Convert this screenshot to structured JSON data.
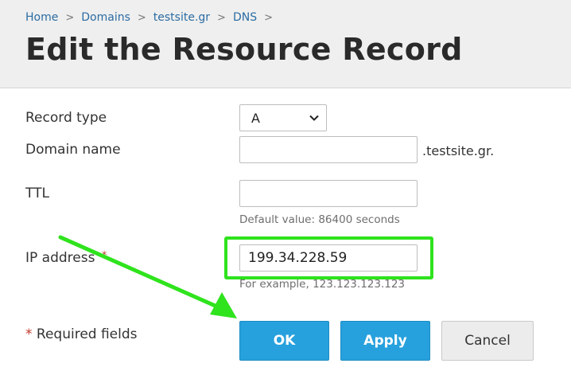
{
  "breadcrumb": {
    "items": [
      "Home",
      "Domains",
      "testsite.gr",
      "DNS"
    ],
    "separator": ">"
  },
  "page": {
    "title": "Edit the Resource Record"
  },
  "form": {
    "record_type": {
      "label": "Record type",
      "value": "A"
    },
    "domain_name": {
      "label": "Domain name",
      "value": "",
      "suffix": ".testsite.gr."
    },
    "ttl": {
      "label": "TTL",
      "value": "",
      "hint": "Default value: 86400 seconds"
    },
    "ip_address": {
      "label": "IP address",
      "required_mark": "*",
      "value": "199.34.228.59",
      "hint": "For example, 123.123.123.123"
    }
  },
  "footer": {
    "required_star": "*",
    "required_text": "Required fields",
    "ok_label": "OK",
    "apply_label": "Apply",
    "cancel_label": "Cancel"
  },
  "colors": {
    "link": "#2b6ca3",
    "primary_button": "#27a1dd",
    "annotation_green": "#2fe31d",
    "required_star": "#c0392b"
  }
}
